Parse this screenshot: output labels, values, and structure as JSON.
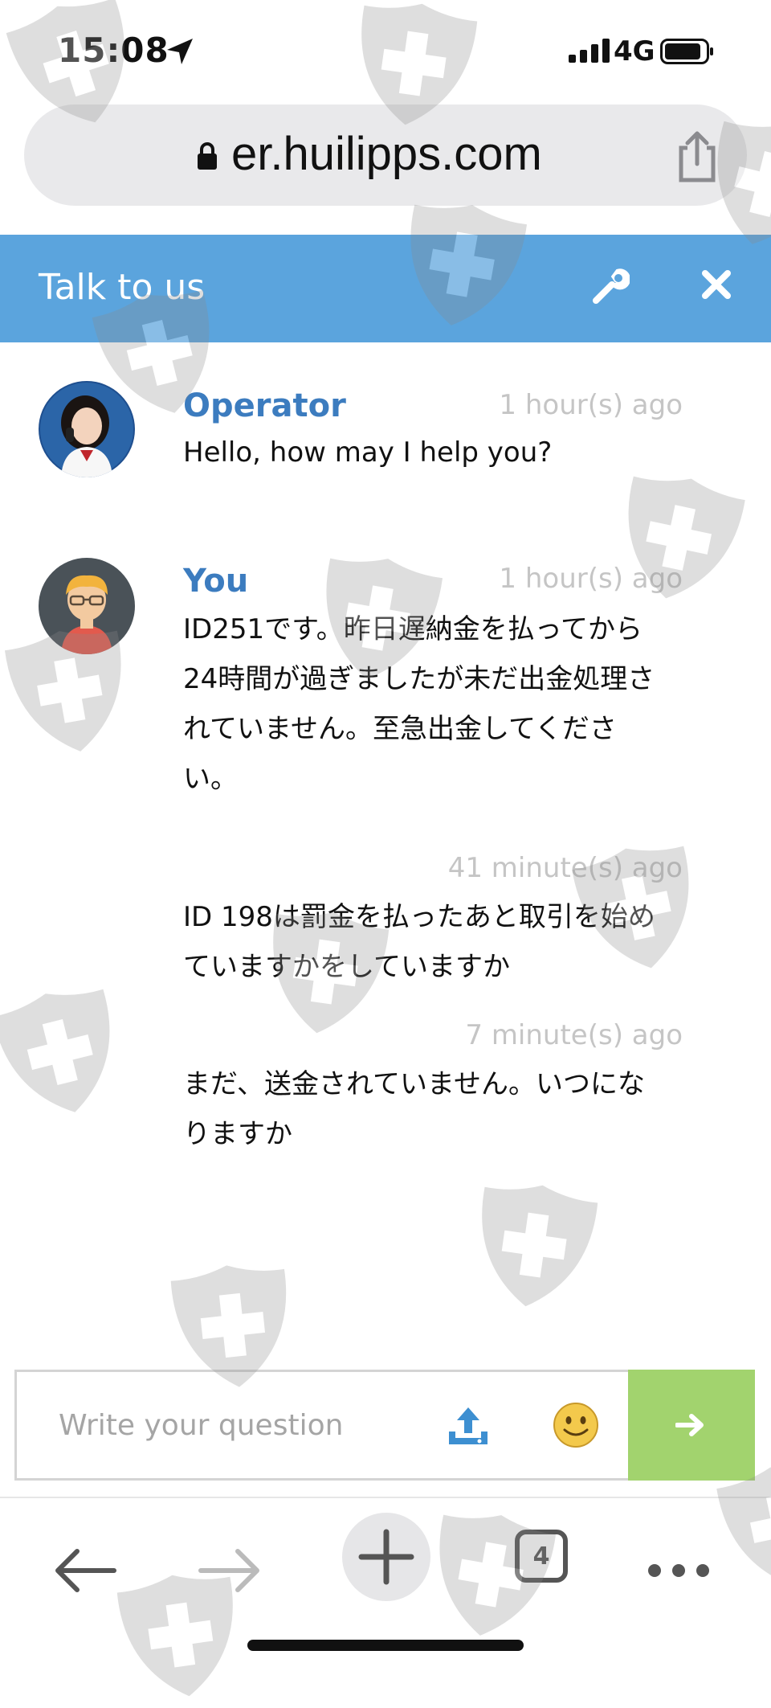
{
  "status_bar": {
    "time": "15:08",
    "network": "4G"
  },
  "browser": {
    "url": "er.huilipps.com",
    "tab_count": "4"
  },
  "chat": {
    "title": "Talk to us",
    "messages": [
      {
        "author": "Operator",
        "time": "1 hour(s) ago",
        "text": "Hello, how may I help you?"
      },
      {
        "author": "You",
        "time": "1 hour(s) ago",
        "lines": [
          "ID251です。昨日遅納金を払ってから",
          "24時間が過ぎましたが未だ出金処理さ",
          "れていません。至急出金してくださ",
          "い。"
        ]
      },
      {
        "author": "",
        "time": "41 minute(s) ago",
        "lines": [
          "ID 198は罰金を払ったあと取引を始め",
          "ていますかをしていますか"
        ]
      },
      {
        "author": "",
        "time": "7 minute(s) ago",
        "lines": [
          "まだ、送金されていません。いつにな",
          "りますか"
        ]
      }
    ],
    "input": {
      "placeholder": "Write your question",
      "value": ""
    }
  },
  "colors": {
    "header_bg": "#5ba4dd",
    "author_name": "#3c7cbf",
    "timestamp": "#c5c5c5",
    "send_button": "#a2d36e",
    "upload_icon": "#3d8fd1",
    "emoji_icon": "#f3c94c"
  },
  "icons": {
    "location": "location-arrow-icon",
    "signal": "signal-bars-icon",
    "battery": "battery-icon",
    "lock": "lock-icon",
    "share": "share-icon",
    "wrench": "wrench-icon",
    "close": "close-icon",
    "upload": "upload-icon",
    "emoji": "smiley-icon",
    "send": "arrow-right-icon",
    "back": "back-arrow-icon",
    "forward": "forward-arrow-icon",
    "new_tab": "plus-icon",
    "tabs": "tabs-icon",
    "more": "more-dots-icon",
    "watermark": "shield-cross-watermark"
  }
}
